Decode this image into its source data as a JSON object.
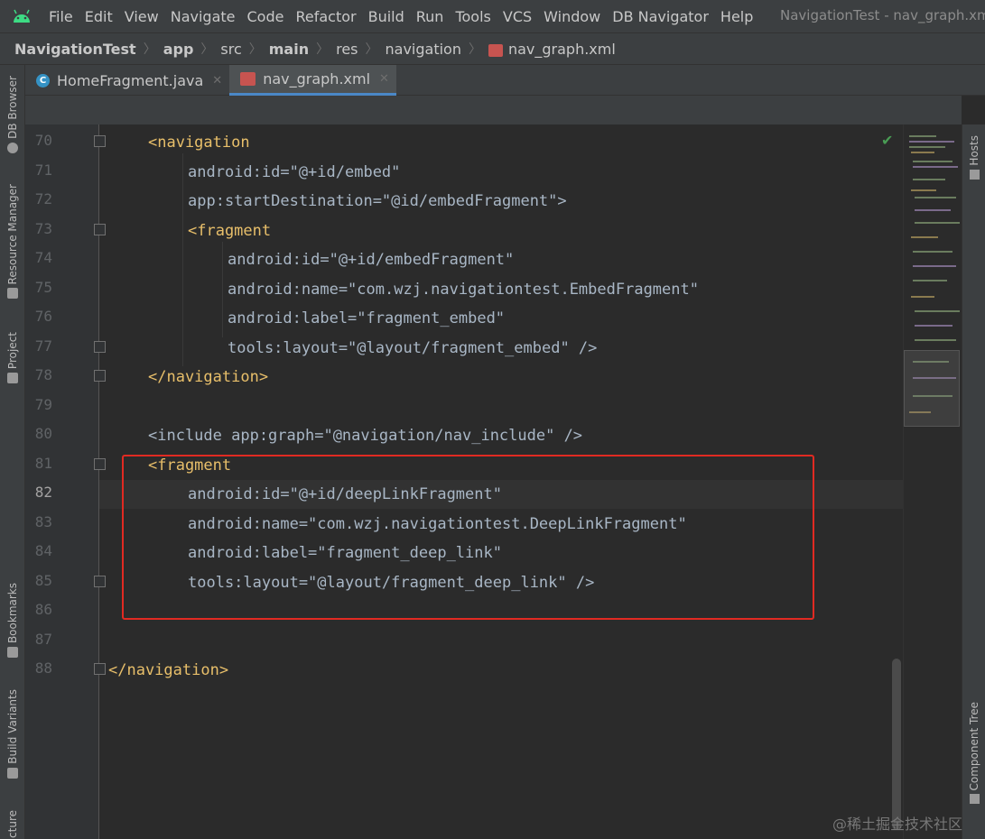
{
  "menubar": {
    "items": [
      "File",
      "Edit",
      "View",
      "Navigate",
      "Code",
      "Refactor",
      "Build",
      "Run",
      "Tools",
      "VCS",
      "Window",
      "DB Navigator",
      "Help"
    ],
    "window_title": "NavigationTest - nav_graph.xml"
  },
  "breadcrumb": [
    "NavigationTest",
    "app",
    "src",
    "main",
    "res",
    "navigation",
    "nav_graph.xml"
  ],
  "tabs": [
    {
      "label": "HomeFragment.java"
    },
    {
      "label": "nav_graph.xml"
    }
  ],
  "left_tools": [
    "DB Browser",
    "Resource Manager",
    "Project",
    "Bookmarks",
    "Build Variants",
    "Structure"
  ],
  "right_tools": [
    "Hosts",
    "Component Tree"
  ],
  "editor": {
    "line_numbers": [
      "70",
      "71",
      "72",
      "73",
      "74",
      "75",
      "76",
      "77",
      "78",
      "79",
      "80",
      "81",
      "82",
      "83",
      "84",
      "85",
      "86",
      "87",
      "88"
    ],
    "current_line": "82",
    "lines": [
      "<navigation",
      "android:id=\"@+id/embed\"",
      "app:startDestination=\"@id/embedFragment\">",
      "<fragment",
      "android:id=\"@+id/embedFragment\"",
      "android:name=\"com.wzj.navigationtest.EmbedFragment\"",
      "android:label=\"fragment_embed\"",
      "tools:layout=\"@layout/fragment_embed\" />",
      "</navigation>",
      "",
      "<include app:graph=\"@navigation/nav_include\" />",
      "<fragment",
      "android:id=\"@+id/deepLinkFragment\"",
      "android:name=\"com.wzj.navigationtest.DeepLinkFragment\"",
      "android:label=\"fragment_deep_link\"",
      "tools:layout=\"@layout/fragment_deep_link\" />",
      "",
      "",
      "</navigation>"
    ]
  },
  "watermark": "@稀土掘金技术社区",
  "colors": {
    "highlight_box": "#e12a22",
    "tag": "#e8bf6a",
    "namespace": "#9876aa",
    "value": "#6a8759",
    "accent": "#4a88c7"
  }
}
